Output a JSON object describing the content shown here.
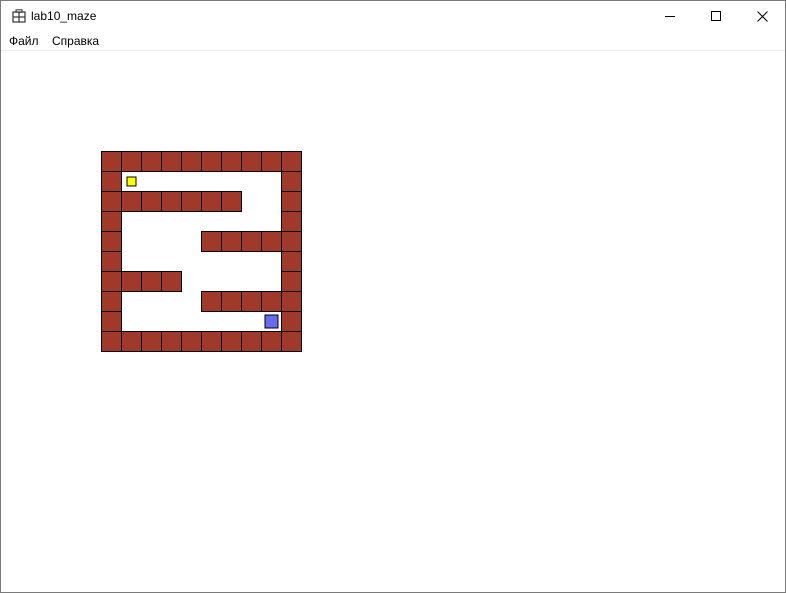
{
  "window": {
    "title": "lab10_maze",
    "app_icon": "maze-app-icon",
    "controls": {
      "minimize_icon": "minimize-icon",
      "maximize_icon": "maximize-icon",
      "close_icon": "close-icon"
    }
  },
  "menu": {
    "items": [
      {
        "label": "Файл"
      },
      {
        "label": "Справка"
      }
    ]
  },
  "maze": {
    "wall_color": "#a0392a",
    "wall_border_color": "#000000",
    "floor_color": "#ffffff",
    "grid": [
      "##########",
      "#........#",
      "#######..#",
      "#........#",
      "#....#####",
      "#........#",
      "####.....#",
      "#....#####",
      "#........#",
      "##########"
    ],
    "player": {
      "row": 1,
      "col": 1,
      "color": "#ffff00"
    },
    "exit": {
      "row": 8,
      "col": 8,
      "color": "#6a6aef"
    }
  }
}
